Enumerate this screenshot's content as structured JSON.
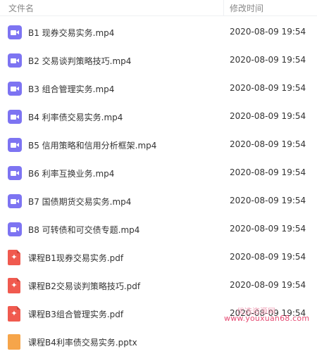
{
  "header": {
    "name_label": "文件名",
    "time_label": "修改时间"
  },
  "files": [
    {
      "type": "video",
      "icon": "video-icon",
      "name": "B1 现券交易实务.mp4",
      "modified": "2020-08-09 19:54"
    },
    {
      "type": "video",
      "icon": "video-icon",
      "name": "B2 交易谈判策略技巧.mp4",
      "modified": "2020-08-09 19:54"
    },
    {
      "type": "video",
      "icon": "video-icon",
      "name": "B3 组合管理实务.mp4",
      "modified": "2020-08-09 19:54"
    },
    {
      "type": "video",
      "icon": "video-icon",
      "name": "B4 利率债交易实务.mp4",
      "modified": "2020-08-09 19:54"
    },
    {
      "type": "video",
      "icon": "video-icon",
      "name": "B5 信用策略和信用分析框架.mp4",
      "modified": "2020-08-09 19:54"
    },
    {
      "type": "video",
      "icon": "video-icon",
      "name": "B6 利率互换业务.mp4",
      "modified": "2020-08-09 19:54"
    },
    {
      "type": "video",
      "icon": "video-icon",
      "name": "B7 国债期货交易实务.mp4",
      "modified": "2020-08-09 19:54"
    },
    {
      "type": "video",
      "icon": "video-icon",
      "name": "B8 可转债和可交债专题.mp4",
      "modified": "2020-08-09 19:54"
    },
    {
      "type": "pdf",
      "icon": "pdf-icon",
      "name": "课程B1现券交易实务.pdf",
      "modified": "2020-08-09 19:54"
    },
    {
      "type": "pdf",
      "icon": "pdf-icon",
      "name": "课程B2交易谈判策略技巧.pdf",
      "modified": "2020-08-09 19:54"
    },
    {
      "type": "pdf",
      "icon": "pdf-icon",
      "name": "课程B3组合管理实务.pdf",
      "modified": "2020-08-09 19:54"
    },
    {
      "type": "pptx",
      "icon": "pptx-icon",
      "name": "课程B4利率债交易实务.pptx",
      "modified": ""
    }
  ],
  "watermark": {
    "text": "www.youxuan68.com",
    "text_faint": "优选资源网"
  },
  "colors": {
    "video_icon": "#7d74f2",
    "pdf_icon": "#f05a4f",
    "pptx_icon": "#f6a54a",
    "watermark": "#e64b73"
  }
}
